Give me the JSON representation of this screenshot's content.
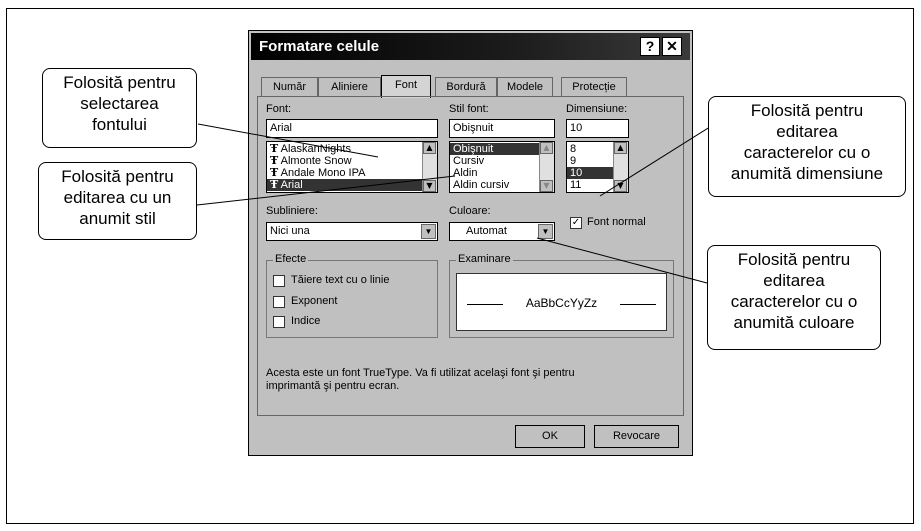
{
  "dialog": {
    "title": "Formatare celule",
    "help_glyph": "?",
    "close_glyph": "✕",
    "tabs": [
      "Număr",
      "Aliniere",
      "Font",
      "Bordură",
      "Modele",
      "Protecție"
    ],
    "font_label": "Font:",
    "font_value": "Arial",
    "font_list": [
      "AlaskanNights",
      "Almonte Snow",
      "Andale Mono IPA",
      "Arial"
    ],
    "style_label": "Stil font:",
    "style_value": "Obişnuit",
    "style_list": [
      "Obişnuit",
      "Cursiv",
      "Aldin",
      "Aldin cursiv"
    ],
    "size_label": "Dimensiune:",
    "size_value": "10",
    "size_list": [
      "8",
      "9",
      "10",
      "11"
    ],
    "underline_label": "Subliniere:",
    "underline_value": "Nici una",
    "color_label": "Culoare:",
    "color_value": "Automat",
    "normal_font_label": "Font normal",
    "effects_label": "Efecte",
    "effects": [
      "Tăiere text cu o linie",
      "Exponent",
      "Indice"
    ],
    "preview_label": "Examinare",
    "preview_text": "AaBbCcYyZz",
    "info_line1": "Acesta este un font TrueType. Va fi utilizat acelaşi font şi pentru",
    "info_line2": "imprimantă şi pentru ecran.",
    "ok_label": "OK",
    "cancel_label": "Revocare"
  },
  "callouts": {
    "font": [
      "Folosită pentru",
      "selectarea",
      "fontului"
    ],
    "style": [
      "Folosită pentru",
      "editarea cu un",
      "anumit stil"
    ],
    "size": [
      "Folosită pentru",
      "editarea",
      "caracterelor cu o",
      "anumită dimensiune"
    ],
    "color": [
      "Folosită pentru",
      "editarea",
      "caracterelor cu o",
      "anumită culoare"
    ]
  }
}
